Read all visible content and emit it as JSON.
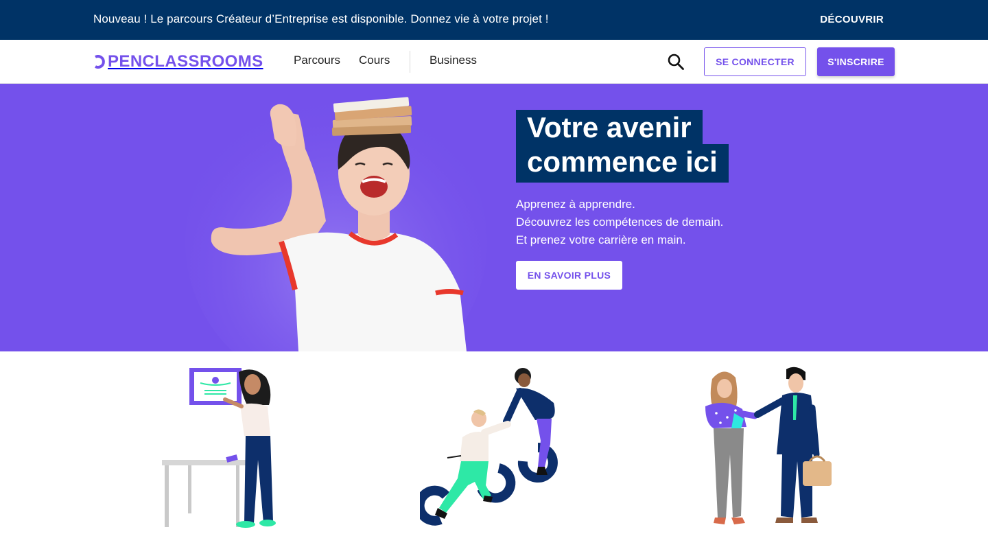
{
  "announcement": {
    "message": "Nouveau ! Le parcours Créateur d’Entreprise est disponible. Donnez vie à votre projet !",
    "cta": "DÉCOUVRIR"
  },
  "header": {
    "logo_text": "PENCLASSROOMS",
    "nav": [
      "Parcours",
      "Cours",
      "Business"
    ],
    "search_icon": "search-icon",
    "login_label": "SE CONNECTER",
    "signup_label": "S'INSCRIRE"
  },
  "hero": {
    "title_line1": "Votre avenir",
    "title_line2": "commence ici",
    "tagline": [
      "Apprenez à apprendre.",
      "Découvrez les compétences de demain.",
      "Et prenez votre carrière en main."
    ],
    "cta": "EN SAVOIR PLUS"
  },
  "colors": {
    "brand_purple": "#7451eb",
    "navy": "#003366",
    "white": "#ffffff"
  }
}
